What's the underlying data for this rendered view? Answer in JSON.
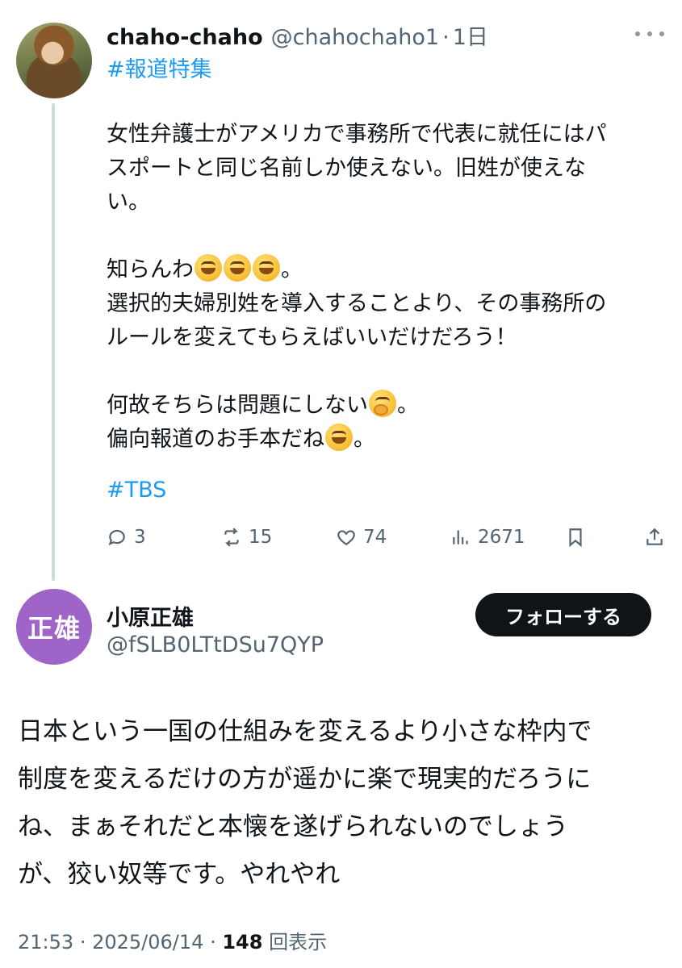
{
  "parent": {
    "name": "chaho-chaho",
    "handle": "@chahochaho1",
    "separator": "·",
    "time": "1日",
    "hashtag_top": "#報道特集",
    "lines": [
      "女性弁護士がアメリカで事務所で代表に就任にはパ",
      "スポートと同じ名前しか使えない。旧姓が使えな",
      "い。",
      "知らんわ",
      "。",
      "選択的夫婦別姓を導入することより、その事務所の",
      "ルールを変えてもらえばいいだけだろう！",
      "何故そちらは問題にしない",
      "。",
      "偏向報道のお手本だね",
      "。"
    ],
    "hashtag_bottom": "#TBS",
    "emoji_names": [
      "rofl-emoji",
      "hand-over-mouth-emoji"
    ],
    "actions": {
      "replies": "3",
      "reposts": "15",
      "likes": "74",
      "views": "2671"
    }
  },
  "reply": {
    "avatar_text": "正雄",
    "name": "小原正雄",
    "handle": "@fSLB0LTtDSu7QYP",
    "follow_label": "フォローする",
    "lines": [
      "日本という一国の仕組みを変えるより小さな枠内で",
      "制度を変えるだけの方が遥かに楽で現実的だろうに",
      "ね、まぁそれだと本懐を遂げられないのでしょう",
      "が、狡い奴等です。やれやれ"
    ],
    "time": "21:53",
    "dot": "·",
    "date": "2025/06/14",
    "views_count": "148",
    "views_label": "回表示"
  },
  "colors": {
    "link": "#1d9bf0",
    "secondary_text": "#536471",
    "follow_bg": "#0f1419",
    "reply_avatar_bg": "#9e64c8"
  }
}
